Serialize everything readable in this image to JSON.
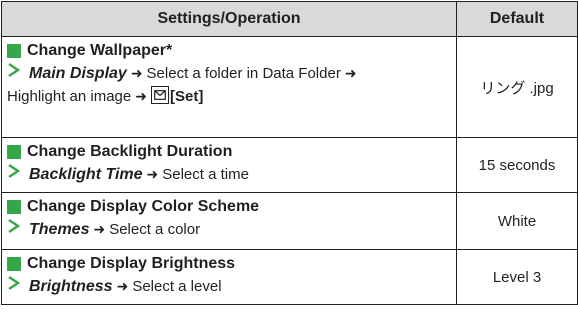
{
  "table": {
    "col_settings": "Settings/Operation",
    "col_default": "Default",
    "rows": [
      {
        "title": "Change Wallpaper*",
        "menu": "Main Display",
        "step1": "Select a folder in Data Folder",
        "step2": "Highlight an image",
        "key_label": "[Set]",
        "default": "リング .jpg"
      },
      {
        "title": "Change Backlight Duration",
        "menu": "Backlight Time",
        "step1": "Select a time",
        "default": "15 seconds"
      },
      {
        "title": "Change Display Color Scheme",
        "menu": "Themes",
        "step1": "Select a color",
        "default": "White"
      },
      {
        "title": "Change Display Brightness",
        "menu": "Brightness",
        "step1": "Select a level",
        "default": "Level 3"
      }
    ]
  },
  "icons": {
    "bullet": "green-square-icon",
    "step": "chevron-right-icon",
    "then": "arrow-right-icon",
    "key": "mail-softkey-icon"
  },
  "colors": {
    "bullet_green": "#35a64a",
    "chevron_green": "#35a64a",
    "header_bg": "#d9d9d9",
    "text": "#231f20"
  }
}
